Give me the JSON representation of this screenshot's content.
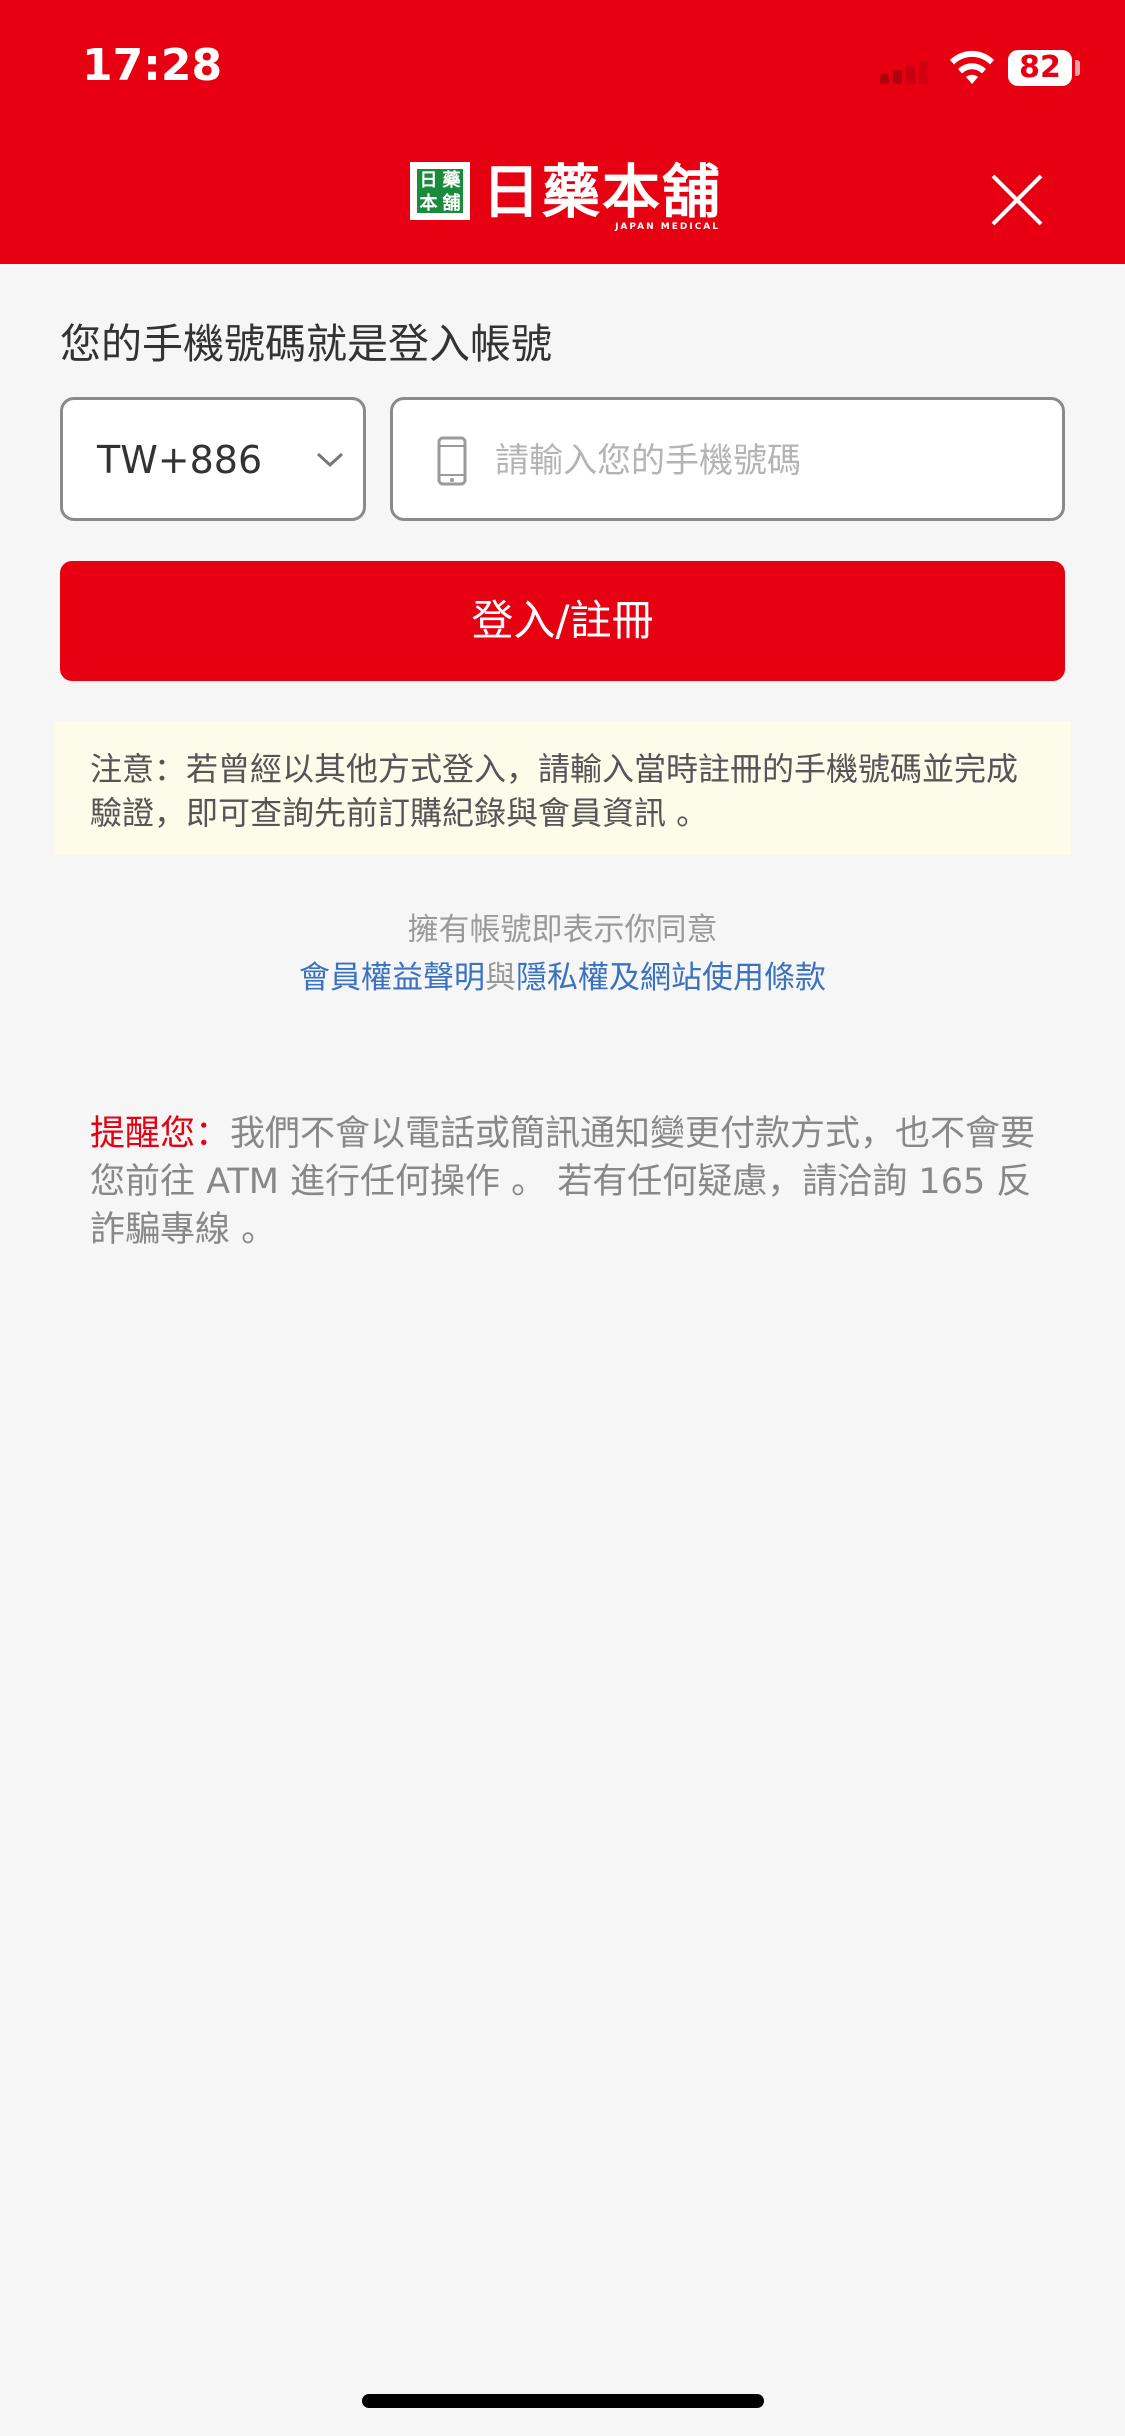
{
  "status_bar": {
    "time": "17:28",
    "battery": "82"
  },
  "header": {
    "logo_chars": [
      "日",
      "藥",
      "本",
      "舖"
    ],
    "logo_text": "日藥本舖",
    "logo_sub": "JAPAN MEDICAL",
    "close_icon": "close-icon"
  },
  "login": {
    "prompt": "您的手機號碼就是登入帳號",
    "country_code": "TW+886",
    "phone_placeholder": "請輸入您的手機號碼",
    "phone_value": "",
    "submit_label": "登入/註冊"
  },
  "notice": "注意：若曾經以其他方式登入，請輸入當時註冊的手機號碼並完成驗證，即可查詢先前訂購紀錄與會員資訊 。",
  "agreement": {
    "prefix": "擁有帳號即表示你同意",
    "link1": "會員權益聲明",
    "conj": "與",
    "link2": "隱私權及網站使用條款"
  },
  "reminder": {
    "label": "提醒您：",
    "text": "我們不會以電話或簡訊通知變更付款方式，也不會要您前往 ATM 進行任何操作 。 若有任何疑慮，請洽詢 165 反詐騙專線 。"
  },
  "colors": {
    "brand_red": "#e60012",
    "link_blue": "#3a72c0",
    "notice_bg": "#fdfbea",
    "logo_green": "#1a8b3a"
  }
}
